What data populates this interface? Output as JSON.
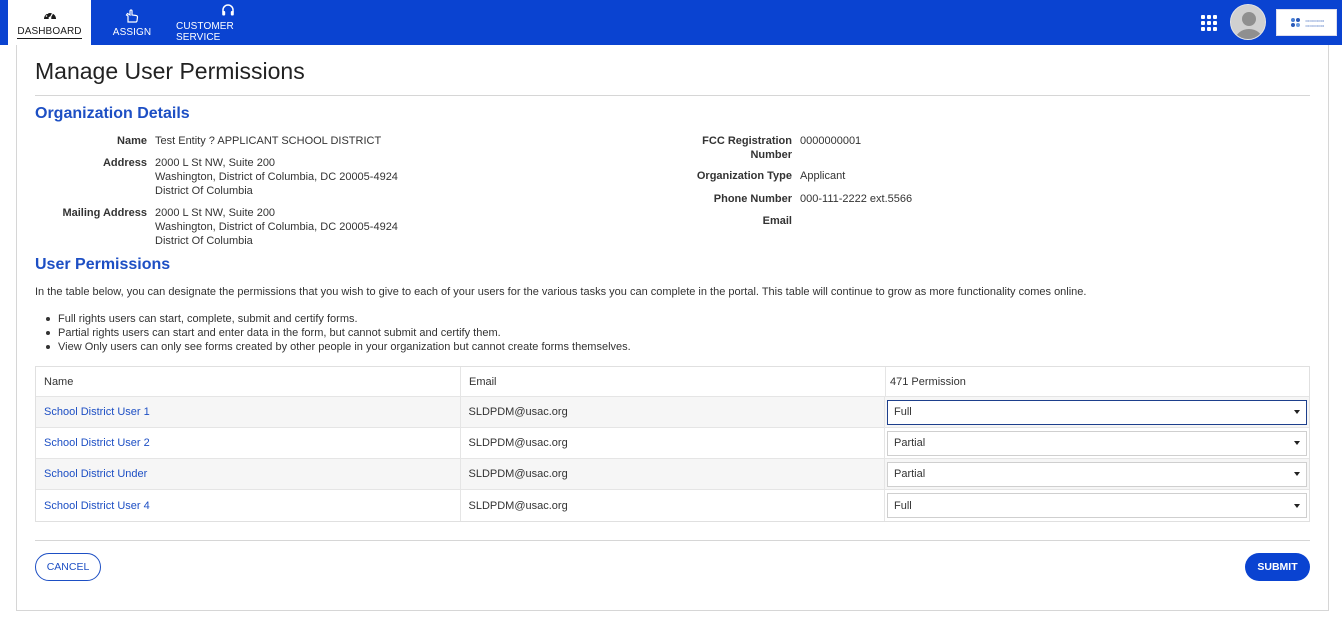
{
  "nav": {
    "items": [
      {
        "label": "DASHBOARD",
        "icon": "dashboard-gauge-icon",
        "active": true
      },
      {
        "label": "ASSIGN",
        "icon": "hand-pointer-icon",
        "active": false
      },
      {
        "label": "CUSTOMER SERVICE",
        "icon": "headset-icon",
        "active": false
      }
    ]
  },
  "page": {
    "title": "Manage User Permissions"
  },
  "org": {
    "heading": "Organization Details",
    "name_label": "Name",
    "name_value": "Test Entity ? APPLICANT SCHOOL DISTRICT",
    "address_label": "Address",
    "address_lines": [
      "2000 L St NW,  Suite 200",
      "Washington, District of Columbia, DC 20005-4924",
      "District Of Columbia"
    ],
    "mailing_label": "Mailing Address",
    "mailing_lines": [
      "2000 L St NW,  Suite 200",
      "Washington, District of Columbia, DC 20005-4924",
      "District Of Columbia"
    ],
    "frn_label_1": "FCC Registration",
    "frn_label_2": "Number",
    "frn_value": "0000000001",
    "type_label": "Organization Type",
    "type_value": "Applicant",
    "phone_label": "Phone Number",
    "phone_value": "000-111-2222 ext.5566",
    "email_label": "Email",
    "email_value": ""
  },
  "permissions": {
    "heading": "User Permissions",
    "intro": "In the table below, you can designate the permissions that you wish to give to each of your users for the various tasks you can complete in the portal. This table will continue to grow as more functionality comes online.",
    "bullets": [
      "Full rights users can start, complete, submit and certify forms.",
      "Partial rights users can start and enter data in the form, but cannot submit and certify them.",
      "View Only users can only see forms created by other people in your organization but cannot create forms themselves."
    ],
    "columns": [
      "Name",
      "Email",
      "471 Permission"
    ],
    "rows": [
      {
        "name": "School District User 1",
        "email": "SLDPDM@usac.org",
        "permission": "Full"
      },
      {
        "name": "School District User 2",
        "email": "SLDPDM@usac.org",
        "permission": "Partial"
      },
      {
        "name": "School District Under",
        "email": "SLDPDM@usac.org",
        "permission": "Partial"
      },
      {
        "name": "School District User 4",
        "email": "SLDPDM@usac.org",
        "permission": "Full"
      }
    ]
  },
  "actions": {
    "cancel": "CANCEL",
    "submit": "SUBMIT"
  },
  "colors": {
    "brand_blue": "#0a43d1",
    "heading_blue": "#1d4fc4"
  }
}
